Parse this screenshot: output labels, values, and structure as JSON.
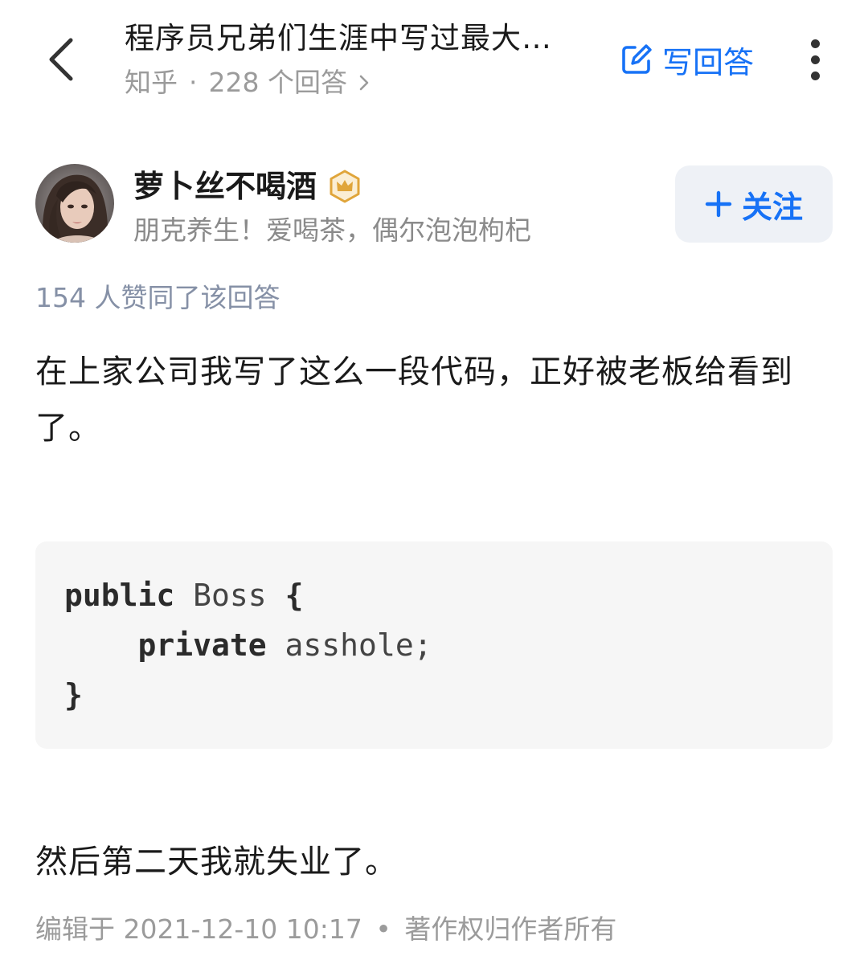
{
  "header": {
    "back_icon": "chevron-left-icon",
    "question_title": "程序员兄弟们生涯中写过最大…",
    "site_name": "知乎",
    "meta_separator": "·",
    "answer_count": "228 个回答",
    "write_answer_label": "写回答",
    "write_answer_icon": "edit-icon",
    "more_icon": "more-vertical-icon",
    "accent_color": "#1772f6"
  },
  "author": {
    "name": "萝卜丝不喝酒",
    "badge_icon": "crown-badge-icon",
    "bio": "朋克养生！爱喝茶，偶尔泡泡枸杞",
    "follow_label": "关注",
    "follow_icon": "plus-icon"
  },
  "answer": {
    "voteup_text": "154 人赞同了该回答",
    "paragraph_1": "在上家公司我写了这么一段代码，正好被老板给看到了。",
    "code": {
      "line_1_keyword": "public",
      "line_1_rest": " Boss ",
      "line_1_brace": "{",
      "line_2_indent": "    ",
      "line_2_keyword": "private",
      "line_2_rest": " asshole;",
      "line_3_brace": "}"
    },
    "paragraph_2": "然后第二天我就失业了。",
    "edited_text": "编辑于 2021-12-10 10:17",
    "footer_separator": "•",
    "copyright_text": "著作权归作者所有"
  }
}
